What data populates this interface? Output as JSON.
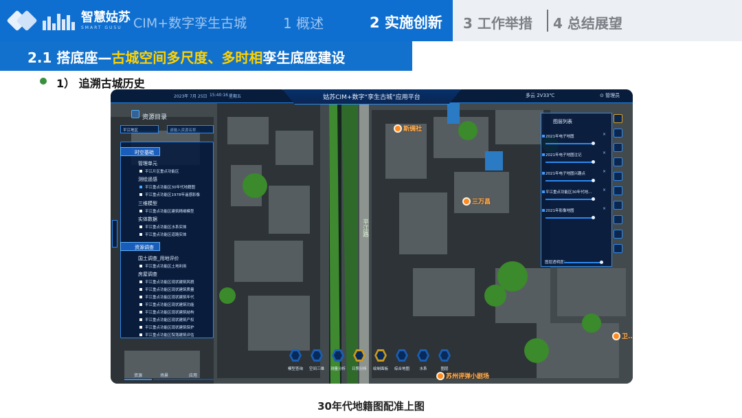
{
  "slide": {
    "logo_text": "智慧姑苏",
    "logo_sub": "SMART GUSU",
    "project_title": "CIM+数字孪生古城",
    "nav": [
      "1 概述",
      "2 实施创新",
      "3 工作举措",
      "4 总结展望"
    ],
    "section_prefix": "2.1 搭底座—",
    "section_highlight_1": "古城空间多尺度、多时相",
    "section_suffix": "孪生底座建设",
    "subtitle": "1） 追溯古城历史",
    "caption": "30年代地籍图配准上图",
    "colors": {
      "header_blue": "#0f6fd0",
      "highlight_yellow": "#ffd200",
      "panel_bg": "#03183c",
      "panel_border": "#2c8af0",
      "poi_orange": "#ff8a1e"
    }
  },
  "app": {
    "title": "姑苏CIM+数字“孪生古城”应用平台",
    "date": "2023年 7月 25日",
    "time": "15:40:16",
    "weekday": "星期五",
    "weather": "多云  2V33℃",
    "admin": "管理员",
    "left_panel": {
      "title": "资源目录",
      "district_select": "平江地区",
      "search_placeholder": "请输入资源名称",
      "groups": [
        {
          "label": "时空基础",
          "nodes": [
            {
              "label": "管理单元",
              "leaves": [
                "平江片区重点功能区"
              ]
            },
            {
              "label": "测绘遥感",
              "leaves": [
                "平江重点功能区30年代地籍图",
                "平江重点功能区1978年遥感影像"
              ]
            },
            {
              "label": "三维模型",
              "leaves": [
                "平江重点功能区建筑精细模型"
              ]
            },
            {
              "label": "实体数据",
              "leaves": [
                "平江重点功能区水系实体",
                "平江重点功能区道路实体"
              ]
            }
          ]
        },
        {
          "label": "资源调查",
          "nodes": [
            {
              "label": "国土调查_用地评价",
              "leaves": [
                "平江重点功能区土地利用"
              ]
            },
            {
              "label": "房屋调查",
              "leaves": [
                "平江重点功能区现状建筑风貌",
                "平江重点功能区现状建筑质量",
                "平江重点功能区现状建筑年代",
                "平江重点功能区现状建筑功能",
                "平江重点功能区现状建筑结构",
                "平江重点功能区现状建筑产权",
                "平江重点功能区现状建筑保护",
                "平江重点功能区院落建筑评估"
              ]
            }
          ]
        }
      ],
      "tabs": [
        "资源",
        "场景",
        "应用"
      ]
    },
    "right_panel": {
      "title": "图层列表",
      "items": [
        "2021年电子地图",
        "2021年电子地图注记",
        "2021年电子地图兴趣点",
        "平江重点功能区30年代地...",
        "2021年影像地图"
      ],
      "opacity_label": "图层透明度："
    },
    "bottom_toolbar": [
      "模型查询",
      "空间三维",
      "测量分析",
      "日照分析",
      "绘制面板",
      "综合地图",
      "水系",
      "图层"
    ],
    "map_labels": {
      "poi": [
        "斯绸社",
        "三万昌",
        "卫...",
        "苏州评弹小剧场"
      ],
      "road": "平江路"
    }
  }
}
